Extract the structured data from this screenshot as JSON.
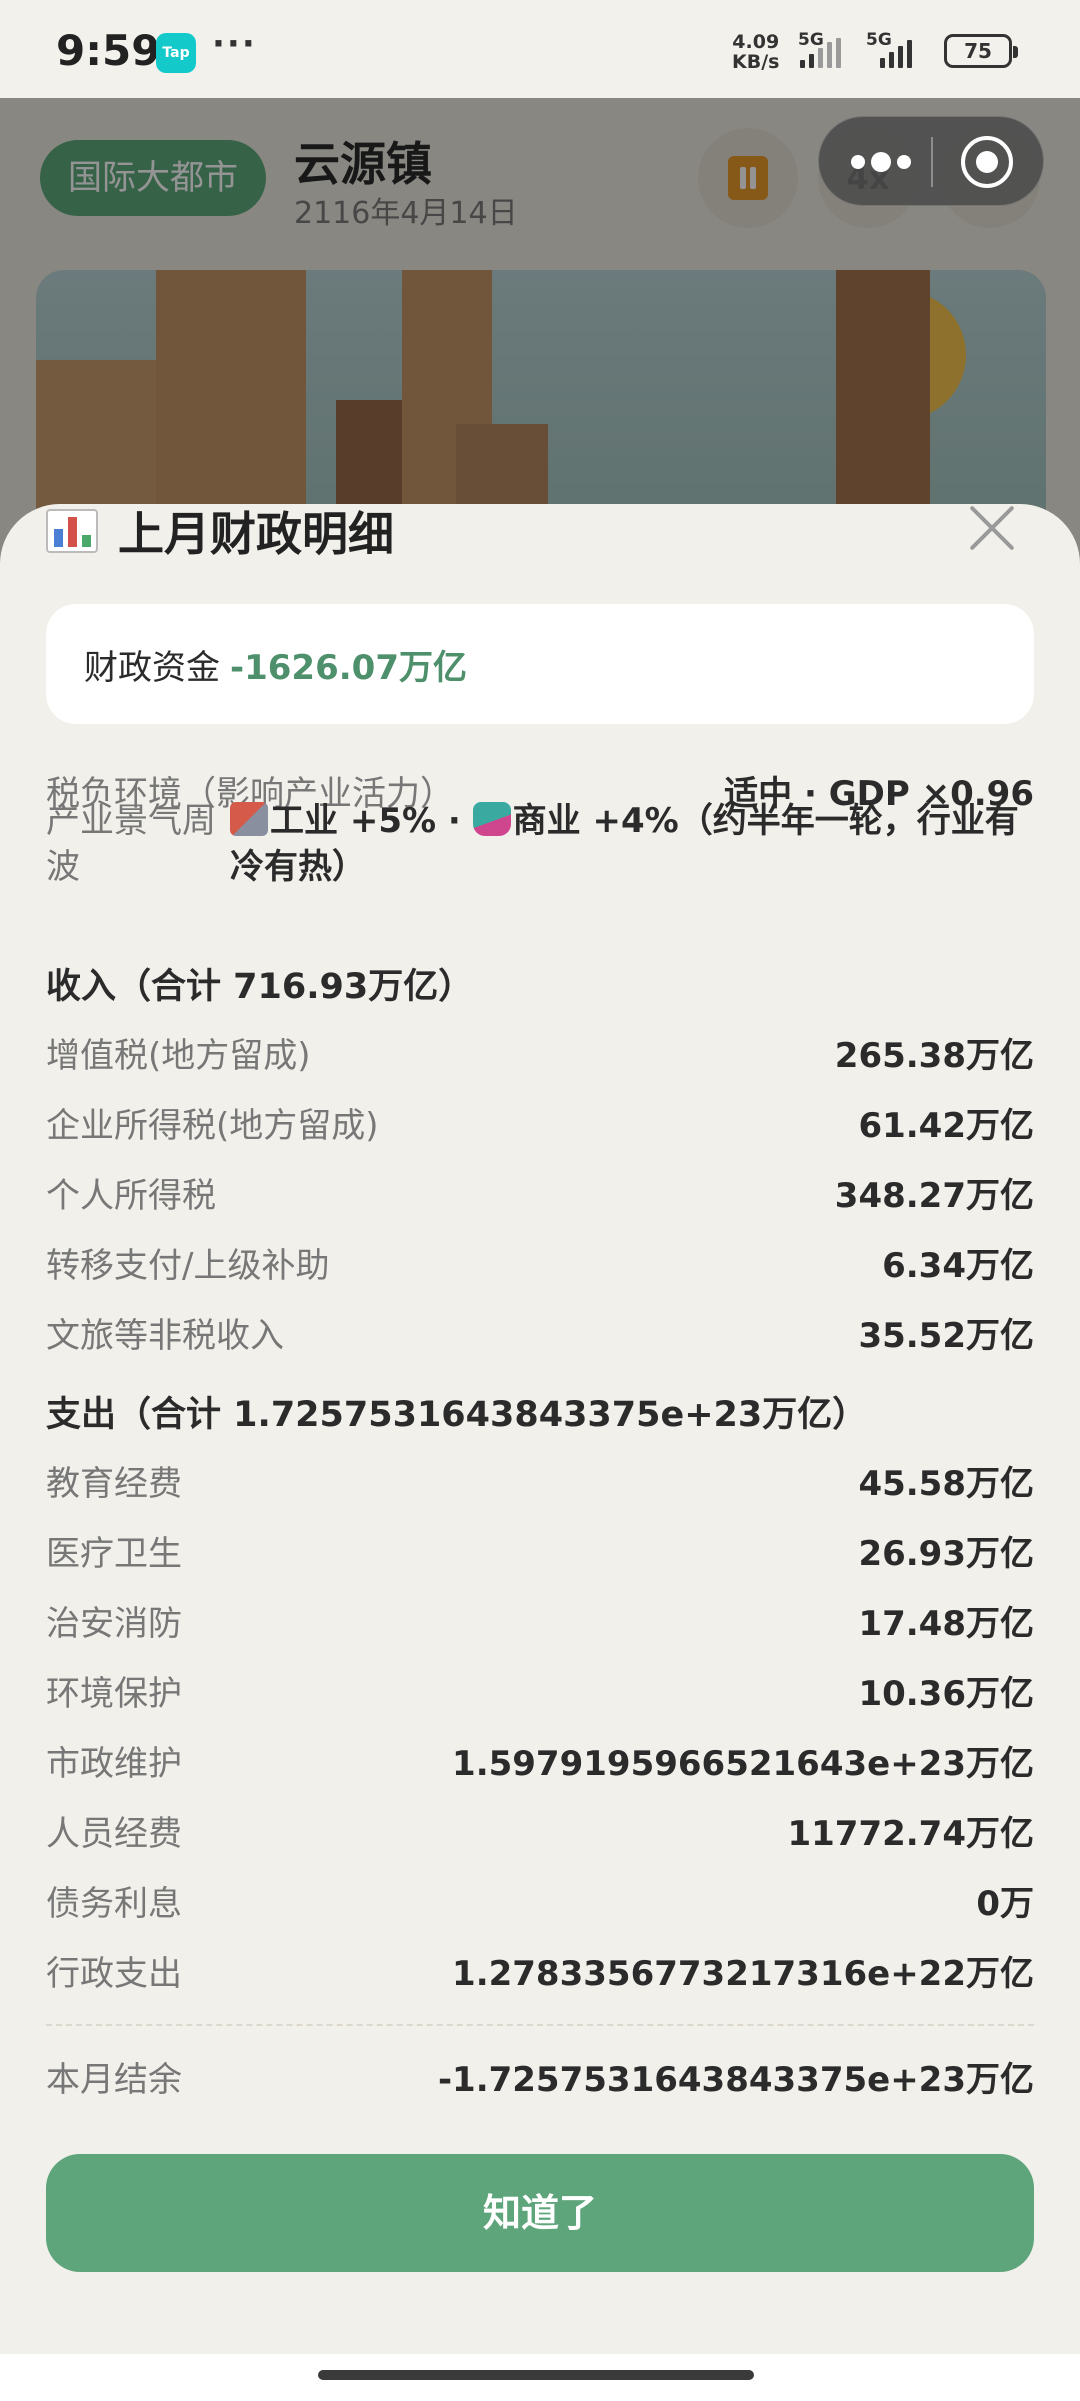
{
  "status_bar": {
    "time": "9:59",
    "tap_label": "Tap",
    "more": "···",
    "net_speed_value": "4.09",
    "net_speed_unit": "KB/s",
    "sim1": "5G",
    "sim2": "5G",
    "battery": "75"
  },
  "app": {
    "city_tag": "国际大都市",
    "town_name": "云源镇",
    "date": "2116年4月14日",
    "speed": "4x"
  },
  "sheet": {
    "title": "上月财政明细",
    "fund_label": "财政资金",
    "fund_value": "-1626.07万亿",
    "tax_env_label": "税负环境（影响产业活力）",
    "tax_env_value": "适中 · GDP ×0.96",
    "cycle_label": "产业景气周波",
    "cycle_industry": "工业 +5% · ",
    "cycle_commerce": "商业 +4%（约半年一轮，行业有冷有热）",
    "income_title": "收入（合计 716.93万亿）",
    "income": [
      {
        "label": "增值税(地方留成)",
        "value": "265.38万亿"
      },
      {
        "label": "企业所得税(地方留成)",
        "value": "61.42万亿"
      },
      {
        "label": "个人所得税",
        "value": "348.27万亿"
      },
      {
        "label": "转移支付/上级补助",
        "value": "6.34万亿"
      },
      {
        "label": "文旅等非税收入",
        "value": "35.52万亿"
      }
    ],
    "expense_title": "支出（合计 1.7257531643843375e+23万亿）",
    "expenses": [
      {
        "label": "教育经费",
        "value": "45.58万亿"
      },
      {
        "label": "医疗卫生",
        "value": "26.93万亿"
      },
      {
        "label": "治安消防",
        "value": "17.48万亿"
      },
      {
        "label": "环境保护",
        "value": "10.36万亿"
      },
      {
        "label": "市政维护",
        "value": "1.5979195966521643e+23万亿"
      },
      {
        "label": "人员经费",
        "value": "11772.74万亿"
      },
      {
        "label": "债务利息",
        "value": "0万"
      },
      {
        "label": "行政支出",
        "value": "1.2783356773217316e+22万亿"
      }
    ],
    "balance_label": "本月结余",
    "balance_value": "-1.7257531643843375e+23万亿",
    "ok_button": "知道了"
  },
  "colors": {
    "accent_green": "#5ea57b",
    "fund_green": "#4e8f6c",
    "sheet_bg": "#f2f0eb"
  }
}
